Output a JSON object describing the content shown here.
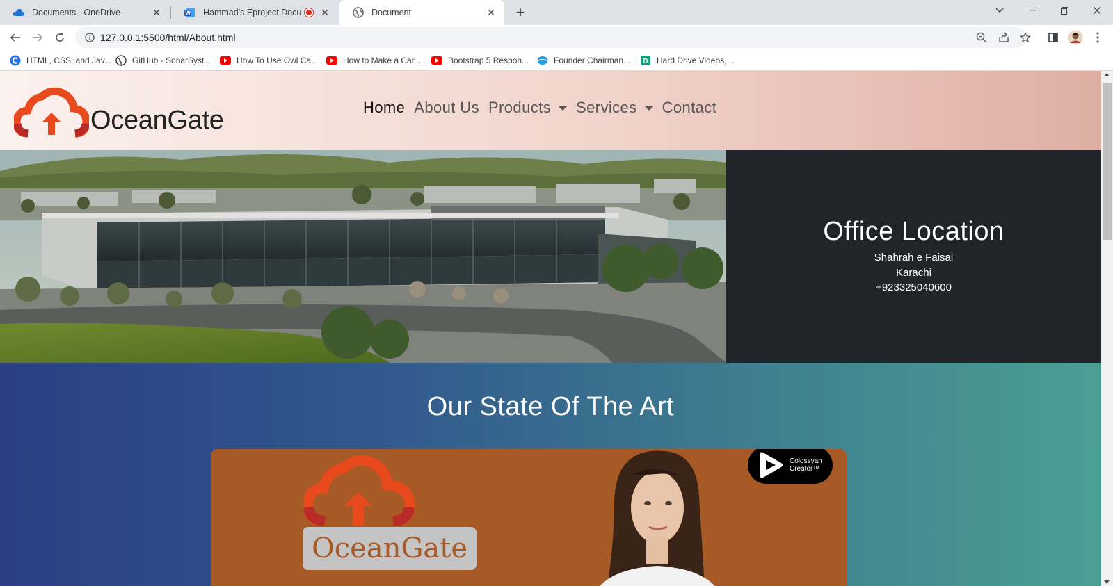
{
  "browser": {
    "tabs": [
      {
        "title": "Documents - OneDrive",
        "icon": "onedrive-cloud-icon",
        "active": false
      },
      {
        "title": "Hammad's Eproject Document",
        "icon": "word-icon",
        "active": false,
        "recording": true
      },
      {
        "title": "Document",
        "icon": "globe-icon",
        "active": true
      }
    ],
    "url": "127.0.0.1:5500/html/About.html",
    "bookmarks": [
      {
        "label": "HTML, CSS, and Jav...",
        "icon": "site-c-icon"
      },
      {
        "label": "GitHub - SonarSyst...",
        "icon": "github-icon"
      },
      {
        "label": "How To Use Owl Ca...",
        "icon": "youtube-icon"
      },
      {
        "label": "How to Make a Car...",
        "icon": "youtube-icon"
      },
      {
        "label": "Bootstrap 5 Respon...",
        "icon": "youtube-icon"
      },
      {
        "label": "Founder Chairman...",
        "icon": "site-wave-icon"
      },
      {
        "label": "Hard Drive Videos,...",
        "icon": "site-d-icon"
      }
    ]
  },
  "site": {
    "brand": "OceanGate",
    "nav": [
      {
        "label": "Home",
        "active": true,
        "dropdown": false
      },
      {
        "label": "About Us",
        "active": false,
        "dropdown": false
      },
      {
        "label": "Products",
        "active": false,
        "dropdown": true
      },
      {
        "label": "Services",
        "active": false,
        "dropdown": true
      },
      {
        "label": "Contact",
        "active": false,
        "dropdown": false
      }
    ],
    "office": {
      "title": "Office Location",
      "lines": [
        "Shahrah e Faisal",
        "Karachi",
        "+923325040600"
      ]
    },
    "section_title": "Our State Of The Art",
    "video": {
      "logo_text": "OceanGate",
      "badge_line1": "Colossyan",
      "badge_line2": "Creator™"
    }
  },
  "colors": {
    "logo_orange": "#e8491d",
    "logo_red": "#c9302c",
    "video_bg": "#a75a26",
    "office_bg": "#212529"
  }
}
